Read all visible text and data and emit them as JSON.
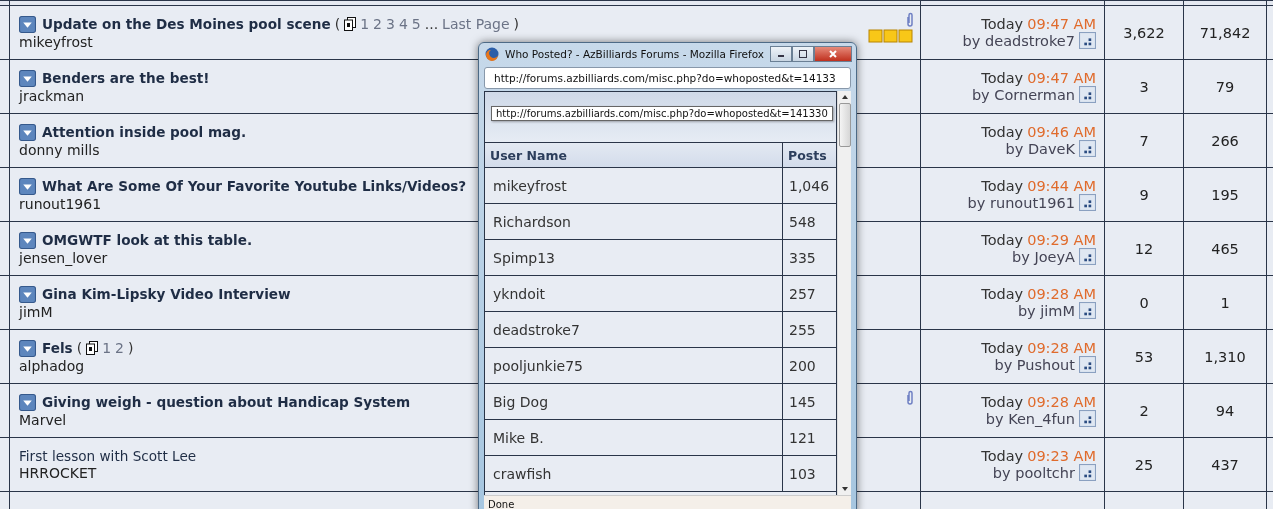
{
  "threads": [
    {
      "title": "Update on the Des Moines pool scene",
      "unread": true,
      "pagination": {
        "open": "(",
        "pages": [
          "1",
          "2",
          "3",
          "4",
          "5"
        ],
        "more": "...",
        "last": "Last Page",
        "close": ")"
      },
      "author": "mikeyfrost",
      "attachment": true,
      "rating": true,
      "day": "Today",
      "time": "09:47 AM",
      "by": "by deadstroke7",
      "replies": "3,622",
      "views": "71,842"
    },
    {
      "title": "Benders are the best!",
      "unread": true,
      "author": "jrackman",
      "attachment": false,
      "rating": false,
      "day": "Today",
      "time": "09:47 AM",
      "by": "by Cornerman",
      "replies": "3",
      "views": "79"
    },
    {
      "title": "Attention inside pool mag.",
      "unread": true,
      "author": "donny mills",
      "attachment": false,
      "rating": false,
      "day": "Today",
      "time": "09:46 AM",
      "by": "by DaveK",
      "replies": "7",
      "views": "266"
    },
    {
      "title": "What Are Some Of Your Favorite Youtube Links/Videos?",
      "unread": true,
      "author": "runout1961",
      "attachment": false,
      "rating": false,
      "day": "Today",
      "time": "09:44 AM",
      "by": "by runout1961",
      "replies": "9",
      "views": "195"
    },
    {
      "title": "OMGWTF look at this table.",
      "unread": true,
      "author": "jensen_lover",
      "attachment": false,
      "rating": false,
      "day": "Today",
      "time": "09:29 AM",
      "by": "by JoeyA",
      "replies": "12",
      "views": "465"
    },
    {
      "title": "Gina Kim-Lipsky Video Interview",
      "unread": true,
      "author": "jimM",
      "attachment": false,
      "rating": false,
      "day": "Today",
      "time": "09:28 AM",
      "by": "by jimM",
      "replies": "0",
      "views": "1"
    },
    {
      "title": "Fels",
      "unread": true,
      "pagination": {
        "open": "(",
        "pages": [
          "1",
          "2"
        ],
        "close": ")"
      },
      "author": "alphadog",
      "attachment": false,
      "rating": false,
      "day": "Today",
      "time": "09:28 AM",
      "by": "by Pushout",
      "replies": "53",
      "views": "1,310"
    },
    {
      "title": "Giving weigh - question about Handicap System",
      "unread": true,
      "author": "Marvel",
      "attachment": true,
      "rating": false,
      "day": "Today",
      "time": "09:28 AM",
      "by": "by Ken_4fun",
      "replies": "2",
      "views": "94"
    },
    {
      "title": "First lesson with Scott Lee",
      "unread": false,
      "author": "HRROCKET",
      "attachment": false,
      "rating": false,
      "day": "Today",
      "time": "09:23 AM",
      "by": "by pooltchr",
      "replies": "25",
      "views": "437"
    }
  ],
  "popup": {
    "title": "Who Posted? - AzBilliards Forums - Mozilla Firefox",
    "url": "http://forums.azbilliards.com/misc.php?do=whoposted&t=14133",
    "tooltip": "http://forums.azbilliards.com/misc.php?do=whoposted&t=141330",
    "columns": [
      "User Name",
      "Posts"
    ],
    "rows": [
      {
        "user": "mikeyfrost",
        "posts": "1,046"
      },
      {
        "user": "Richardson",
        "posts": "548"
      },
      {
        "user": "Spimp13",
        "posts": "335"
      },
      {
        "user": "ykndoit",
        "posts": "257"
      },
      {
        "user": "deadstroke7",
        "posts": "255"
      },
      {
        "user": "pooljunkie75",
        "posts": "200"
      },
      {
        "user": "Big Dog",
        "posts": "145"
      },
      {
        "user": "Mike B.",
        "posts": "121"
      },
      {
        "user": "crawfish",
        "posts": "103"
      }
    ],
    "status": "Done"
  }
}
